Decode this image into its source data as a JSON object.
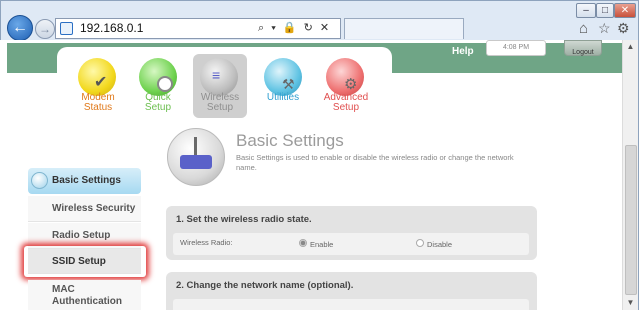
{
  "browser": {
    "address": "192.168.0.1",
    "address_icons": "⌕ ▾ 🔒 ↻ ✕",
    "window_controls": [
      "–",
      "□",
      "✕"
    ]
  },
  "header": {
    "help": "Help",
    "time": "4:08 PM",
    "logout": "Logout"
  },
  "nav": [
    {
      "label1": "Modem",
      "label2": "Status",
      "color": "#e07a1c"
    },
    {
      "label1": "Quick",
      "label2": "Setup",
      "color": "#6cbf4f"
    },
    {
      "label1": "Wireless",
      "label2": "Setup",
      "color": "#8f8f8f"
    },
    {
      "label1": "Utilities",
      "label2": "",
      "color": "#2f9fd0"
    },
    {
      "label1": "Advanced",
      "label2": "Setup",
      "color": "#e05050"
    }
  ],
  "sidebar": [
    "Basic Settings",
    "Wireless Security",
    "Radio Setup",
    "SSID Setup",
    "MAC",
    "Authentication"
  ],
  "page": {
    "title": "Basic Settings",
    "description": "Basic Settings is used to enable or disable the wireless radio or change the network name."
  },
  "section1": {
    "title": "1. Set the wireless radio state.",
    "field": "Wireless Radio:",
    "opt1": "Enable",
    "opt2": "Disable"
  },
  "section2": {
    "title": "2. Change the network name (optional)."
  }
}
